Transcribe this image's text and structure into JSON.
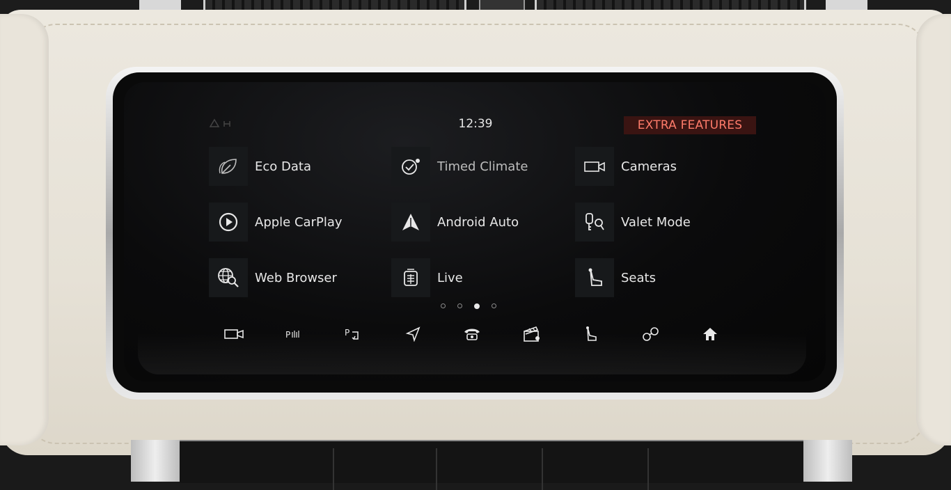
{
  "status": {
    "clock": "12:39",
    "section_title": "EXTRA FEATURES"
  },
  "apps": [
    {
      "label": "Eco Data",
      "icon": "leaf-icon"
    },
    {
      "label": "Timed Climate",
      "icon": "climate-timer-icon"
    },
    {
      "label": "Cameras",
      "icon": "camera-icon"
    },
    {
      "label": "Apple CarPlay",
      "icon": "carplay-icon"
    },
    {
      "label": "Android Auto",
      "icon": "android-auto-icon"
    },
    {
      "label": "Valet Mode",
      "icon": "valet-keys-icon"
    },
    {
      "label": "Web Browser",
      "icon": "globe-search-icon"
    },
    {
      "label": "Live",
      "icon": "live-icon"
    },
    {
      "label": "Seats",
      "icon": "seat-icon"
    }
  ],
  "pager": {
    "pages": 4,
    "current": 3
  },
  "dock": [
    "camera-icon",
    "parking-sensor-icon",
    "park-assist-icon",
    "navigation-icon",
    "phone-icon",
    "media-icon",
    "seat-icon",
    "connectivity-icon",
    "home-icon"
  ],
  "colors": {
    "section_bg": "#3a1412",
    "section_text": "#ff7b6a",
    "tile_bg": "#17191b",
    "text": "#e8e8e8"
  }
}
